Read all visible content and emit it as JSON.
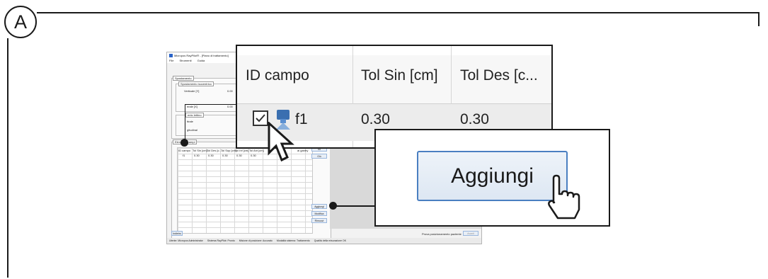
{
  "badge": "A",
  "app": {
    "title": "Micropos RayPilot® - [Piano di trattamento]",
    "menu": [
      "File",
      "Strumenti",
      "Guida"
    ],
    "section_main": "Spostamento",
    "section_isocenter": "Spostamento isocentrico",
    "row_vertical": "Verticale [Y]",
    "row_vertical_val": "0.00",
    "row_lateral": "erale [X]",
    "row_lateral_val": "0.00",
    "section_angle": "ento lettino",
    "row_angle1": "ttrale",
    "row_angle2": "gitudinal",
    "section_fields": "Elenco ... campi",
    "table_headers": [
      "ID campo",
      "Tol Sin [cm]",
      "Tol Des [c...",
      "Tol Sup [cm]",
      "Tol Inf [cm]",
      "Tol Ant [cm]"
    ],
    "table_row": [
      "f1",
      "0.30",
      "0.30",
      "0.30",
      "0.30",
      "0.30"
    ],
    "right_label": "ai gantry",
    "btn_su": "Su",
    "btn_giu": "Giù",
    "btn_aggiungi": "Aggiungi",
    "btn_modifica": "Modifica",
    "btn_rimuovi": "Rimuovi",
    "btn_indietro": "Indietro",
    "btn_avanti": "Avanti",
    "pos_label": "Prova posizionamento paziente",
    "status": [
      "Utente: Micropos Administrator",
      "Sistema RayPilot: Pronto",
      "Misione di posizione: Accurato",
      "Modalità sistema: Trattamento",
      "Qualità della misurazione OK"
    ]
  },
  "zoom_table": {
    "headers": [
      "ID campo",
      "Tol Sin [cm]",
      "Tol Des [c..."
    ],
    "row": {
      "id": "f1",
      "tol_sin": "0.30",
      "tol_des": "0.30"
    }
  },
  "zoom_button": {
    "label": "Aggiungi"
  }
}
